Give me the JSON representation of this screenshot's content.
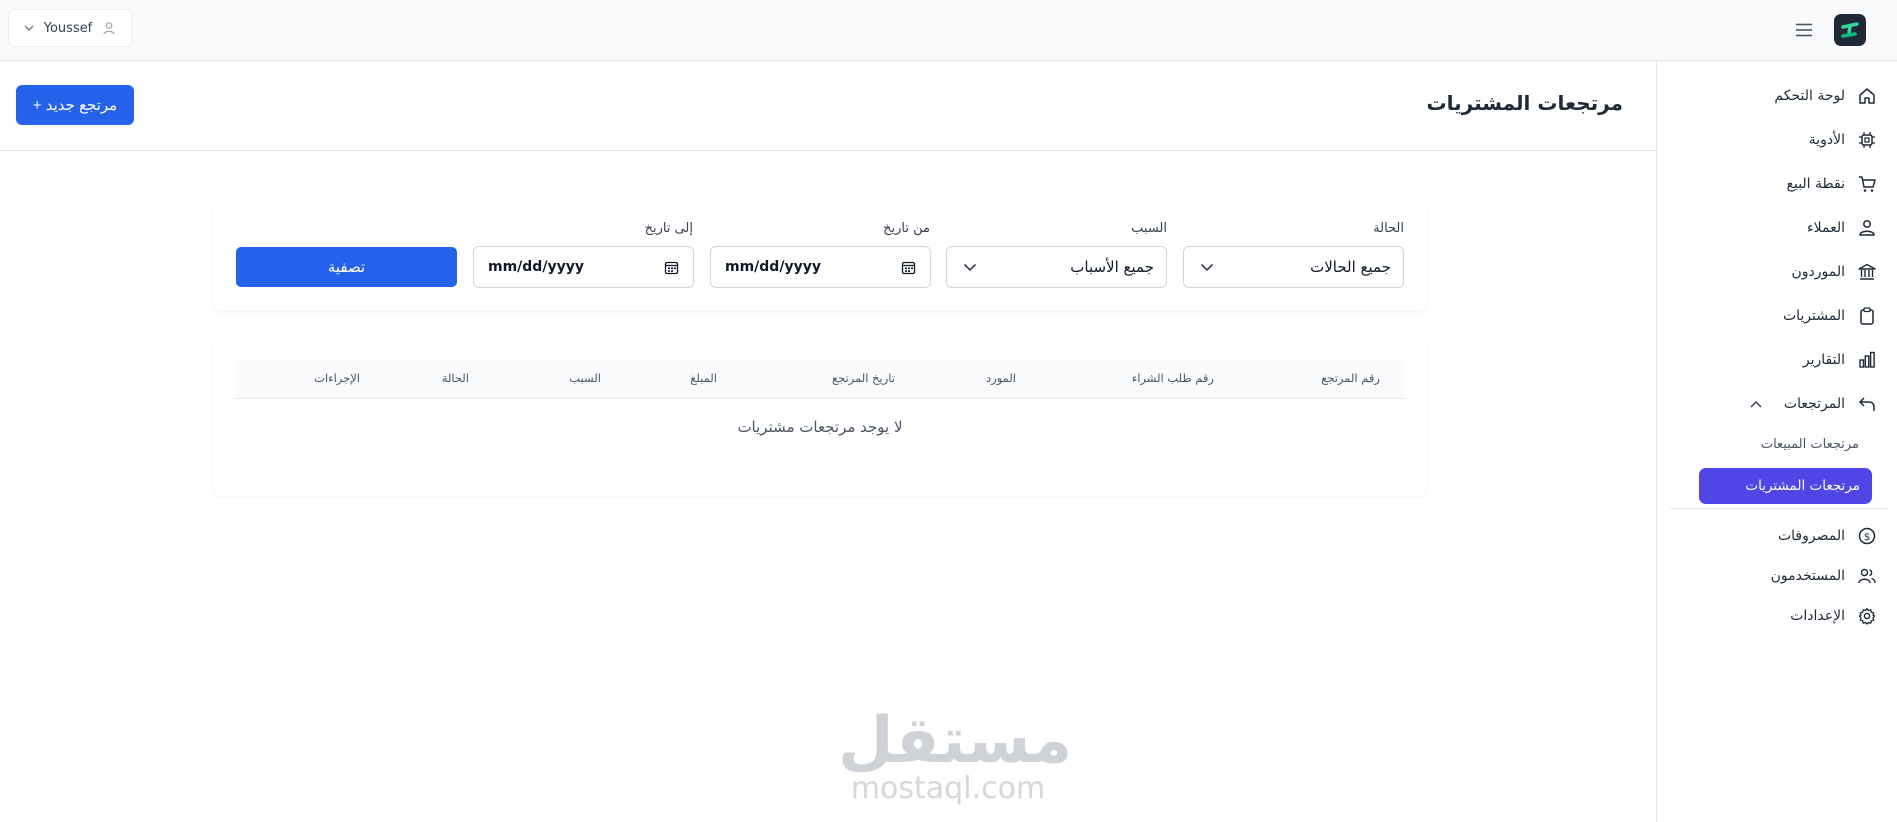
{
  "topbar": {
    "user_name": "Youssef"
  },
  "sidebar": {
    "items": [
      {
        "label": "لوحة التحكم",
        "icon": "home-icon"
      },
      {
        "label": "الأدوية",
        "icon": "chip-icon"
      },
      {
        "label": "نقطة البيع",
        "icon": "cart-icon"
      },
      {
        "label": "العملاء",
        "icon": "customer-icon"
      },
      {
        "label": "الموردون",
        "icon": "bank-icon"
      },
      {
        "label": "المشتريات",
        "icon": "clipboard-icon"
      },
      {
        "label": "التقارير",
        "icon": "bar-chart-icon"
      },
      {
        "label": "المرتجعات",
        "icon": "return-arrow-icon"
      },
      {
        "label": "المصروفات",
        "icon": "dollar-icon"
      },
      {
        "label": "المستخدمون",
        "icon": "users-icon"
      },
      {
        "label": "الإعدادات",
        "icon": "gear-icon"
      }
    ],
    "subitems": [
      {
        "label": "مرتجعات المبيعات"
      },
      {
        "label": "مرتجعات المشتريات"
      }
    ],
    "active_color": "#4f46e5"
  },
  "header": {
    "title": "مرتجعات المشتريات",
    "new_button": "+ مرتجع جديد"
  },
  "filters": {
    "status_label": "الحالة",
    "status_value": "جميع الحالات",
    "reason_label": "السبب",
    "reason_value": "جميع الأسباب",
    "from_label": "من تاريخ",
    "from_placeholder": "mm/dd/yyyy",
    "to_label": "إلى تاريخ",
    "to_placeholder": "mm/dd/yyyy",
    "filter_button": "تصفية"
  },
  "table": {
    "columns": [
      "رقم المرتجع",
      "رقم طلب الشراء",
      "المورد",
      "تاريخ المرتجع",
      "المبلغ",
      "السبب",
      "الحالة",
      "الإجراءات"
    ],
    "empty_text": "لا يوجد مرتجعات مشتريات"
  },
  "watermark": {
    "ar": "مستقل",
    "en": "mostaql.com"
  },
  "colors": {
    "primary": "#2563eb",
    "sidebar_active": "#4f46e5"
  }
}
